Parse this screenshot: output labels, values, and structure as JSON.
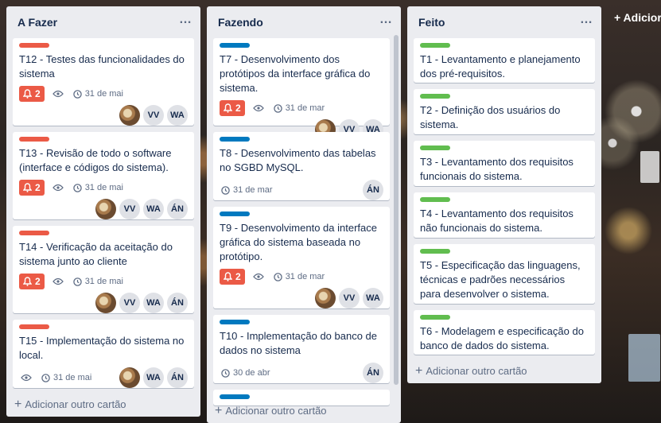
{
  "board": {
    "add_list_label": "+ Adicior",
    "lists": [
      {
        "title": "A Fazer",
        "menu": "…",
        "add_card": "Adicionar outro cartão",
        "cards": [
          {
            "label_color": "#eb5a46",
            "title": "T12 - Testes das funcionalidades do sistema",
            "notifications": "2",
            "due": "31 de mai",
            "members": [
              "photo",
              "VV",
              "WA"
            ]
          },
          {
            "label_color": "#eb5a46",
            "title": "T13 - Revisão de todo o software (interface e códigos do sistema).",
            "notifications": "2",
            "due": "31 de mai",
            "members": [
              "photo",
              "VV",
              "WA",
              "ÁN"
            ]
          },
          {
            "label_color": "#eb5a46",
            "title": "T14 - Verificação da aceitação do sistema junto ao cliente",
            "notifications": "2",
            "due": "31 de mai",
            "members": [
              "photo",
              "VV",
              "WA",
              "ÁN"
            ]
          },
          {
            "label_color": "#eb5a46",
            "title": "T15 - Implementação do sistema no local.",
            "notifications": "",
            "due": "31 de mai",
            "members": [
              "photo",
              "WA",
              "ÁN"
            ]
          }
        ]
      },
      {
        "title": "Fazendo",
        "menu": "…",
        "add_card": "Adicionar outro cartão",
        "cards": [
          {
            "label_color": "#0079bf",
            "title": "T7 - Desenvolvimento dos protótipos da interface gráfica do sistema.",
            "notifications": "2",
            "due": "31 de mar",
            "members": [
              "photo",
              "VV",
              "WA"
            ]
          },
          {
            "label_color": "#0079bf",
            "title": "T8 - Desenvolvimento das tabelas no SGBD MySQL.",
            "notifications": "",
            "due": "31 de mar",
            "members": [
              "ÁN"
            ]
          },
          {
            "label_color": "#0079bf",
            "title": "T9 - Desenvolvimento da interface gráfica do sistema baseada no protótipo.",
            "notifications": "2",
            "due": "31 de mar",
            "members": [
              "photo",
              "VV",
              "WA"
            ]
          },
          {
            "label_color": "#0079bf",
            "title": "T10 - Implementação do banco de dados no sistema",
            "notifications": "",
            "due": "30 de abr",
            "members": [
              "ÁN"
            ]
          }
        ]
      },
      {
        "title": "Feito",
        "menu": "…",
        "add_card": "Adicionar outro cartão",
        "cards": [
          {
            "label_color": "#61bd4f",
            "title": "T1 - Levantamento e planejamento dos pré-requisitos."
          },
          {
            "label_color": "#61bd4f",
            "title": "T2 - Definição dos usuários do sistema."
          },
          {
            "label_color": "#61bd4f",
            "title": "T3 - Levantamento dos requisitos funcionais do sistema."
          },
          {
            "label_color": "#61bd4f",
            "title": "T4 - Levantamento dos requisitos não funcionais do sistema."
          },
          {
            "label_color": "#61bd4f",
            "title": "T5 - Especificação das linguagens, técnicas e padrões necessários para desenvolver o sistema."
          },
          {
            "label_color": "#61bd4f",
            "title": "T6 - Modelagem e especificação do banco de dados do sistema."
          }
        ]
      }
    ]
  },
  "icons": {
    "bell": "bell-icon",
    "watch": "eye-icon",
    "due": "clock-icon",
    "photo_avatar": "user-photo-avatar"
  },
  "colors": {
    "notification_red": "#eb5a46",
    "list_bg": "#ebecf0"
  }
}
